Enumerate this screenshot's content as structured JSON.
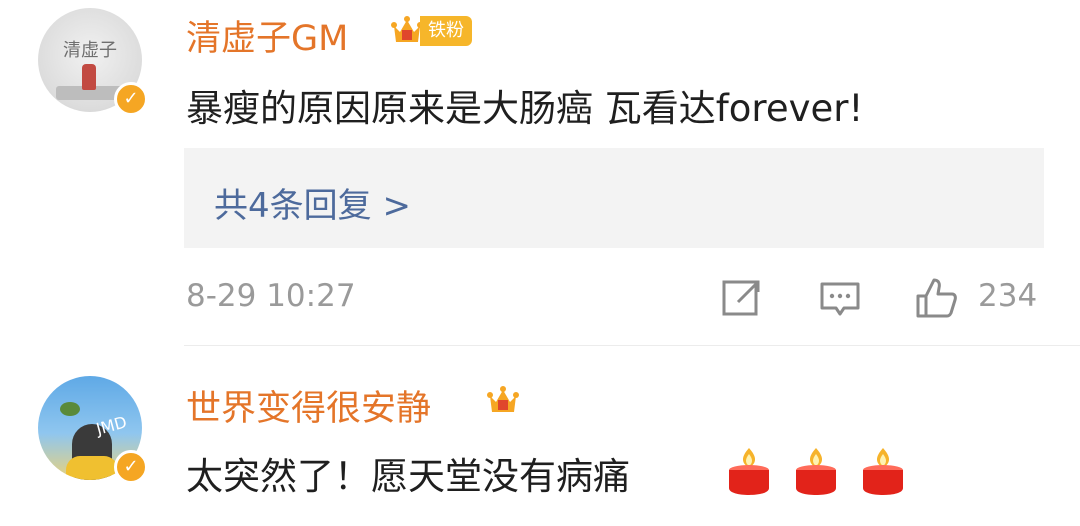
{
  "comments": [
    {
      "avatar_text": "清虚子",
      "username": "清虚子GM",
      "fan_badge": "铁粉",
      "text": "暴瘦的原因原来是大肠癌  瓦看达forever!",
      "replies_label": "共4条回复 >",
      "time": "8-29 10:27",
      "likes": "234",
      "icons": [
        "verified-v-icon",
        "crown-badge-icon",
        "share-icon",
        "comment-icon",
        "like-icon"
      ]
    },
    {
      "avatar_text": "JMD",
      "username": "世界变得很安静",
      "text": "太突然了！愿天堂没有病痛",
      "emoji": [
        "candle-icon",
        "candle-icon",
        "candle-icon"
      ],
      "icons": [
        "verified-v-icon",
        "crown-badge-icon"
      ]
    }
  ],
  "colors": {
    "username": "#e47529",
    "reply_link": "#4d6a9c",
    "meta": "#9a9a9a",
    "verified": "#f5a623",
    "reply_bg": "#f3f3f3"
  }
}
